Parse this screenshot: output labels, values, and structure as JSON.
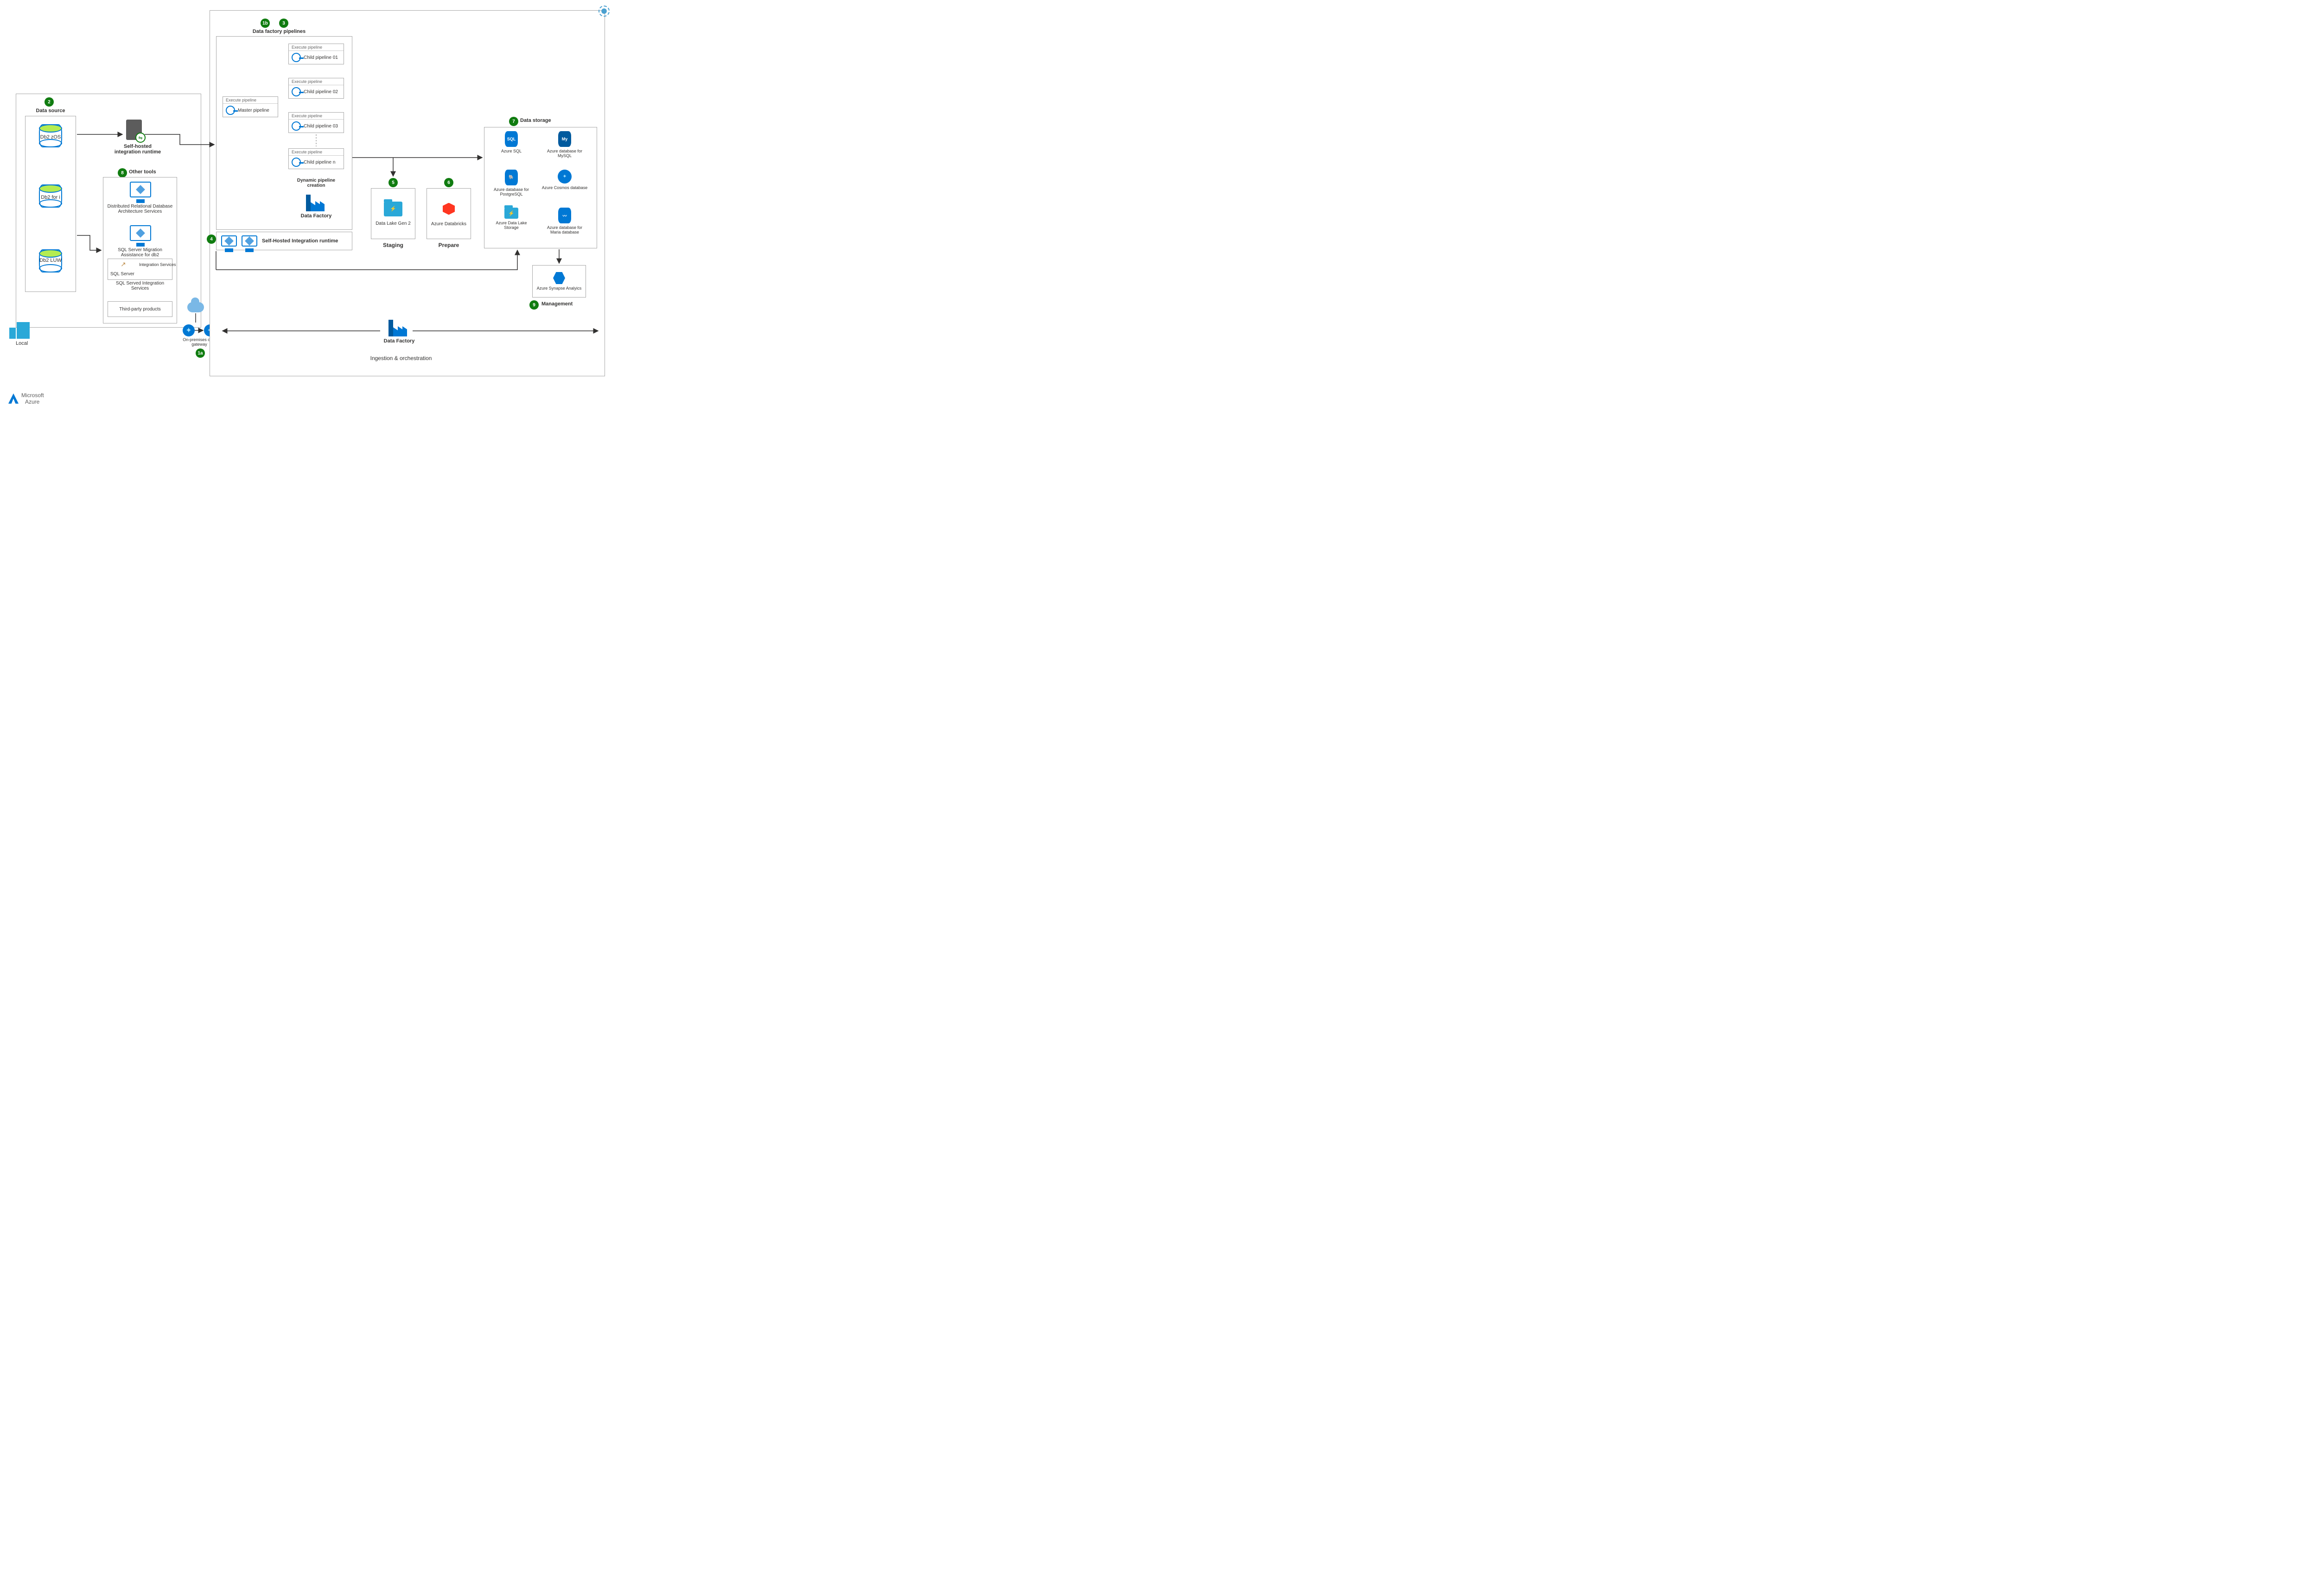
{
  "local": {
    "label": "Local",
    "data_source": {
      "title": "Data source",
      "badge": "2",
      "dbs": [
        "Db2 zOS",
        "Db2 for i",
        "Db2 LUW"
      ]
    },
    "shir": {
      "title": "Self-hosted integration runtime"
    },
    "other_tools": {
      "title": "Other tools",
      "badge": "8",
      "items": [
        "Distributed Relational Database Architecture Services",
        "SQL Server Migration Assistance for db2"
      ],
      "ssis_brand": "SQL Server",
      "ssis_side": "Integration Services",
      "ssis_caption": "SQL Served Integration Services",
      "third_party": "Third-party products"
    },
    "gateway": {
      "label": "On-premises data gateway",
      "badge": "1a"
    }
  },
  "azure": {
    "pipelines": {
      "title": "Data factory pipelines",
      "badges": [
        "1b",
        "3"
      ],
      "master": {
        "header": "Execute pipeline",
        "name": "Master pipeline"
      },
      "children_header": "Execute pipeline",
      "children": [
        "Child pipeline 01",
        "Child pipeline 02",
        "Child pipeline 03",
        "Child pipeline n"
      ],
      "dynamic_label": "Dynamic pipeline creation",
      "df_label": "Data Factory"
    },
    "shir2": {
      "label": "Self-Hosted Integration runtime",
      "badge": "4"
    },
    "staging": {
      "badge": "5",
      "service": "Data Lake Gen 2",
      "caption": "Staging"
    },
    "prepare": {
      "badge": "6",
      "service": "Azure Databricks",
      "caption": "Prepare"
    },
    "storage": {
      "title": "Data storage",
      "badge": "7",
      "services": [
        {
          "name": "Azure SQL",
          "tag": "SQL"
        },
        {
          "name": "Azure database for MySQL",
          "tag": "My"
        },
        {
          "name": "Azure database for PostgreSQL",
          "tag": "PG"
        },
        {
          "name": "Azure Cosmos database",
          "tag": "✦"
        },
        {
          "name": "Azure Data Lake Storage",
          "tag": "⚡"
        },
        {
          "name": "Azure database for Maria database",
          "tag": "M"
        }
      ]
    },
    "management": {
      "badge": "9",
      "service": "Azure Synapse Analyics",
      "caption": "Management"
    },
    "ingestion": {
      "df_label": "Data Factory",
      "caption": "Ingestion & orchestration"
    }
  },
  "footer": {
    "brand_line1": "Microsoft",
    "brand_line2": "Azure"
  }
}
